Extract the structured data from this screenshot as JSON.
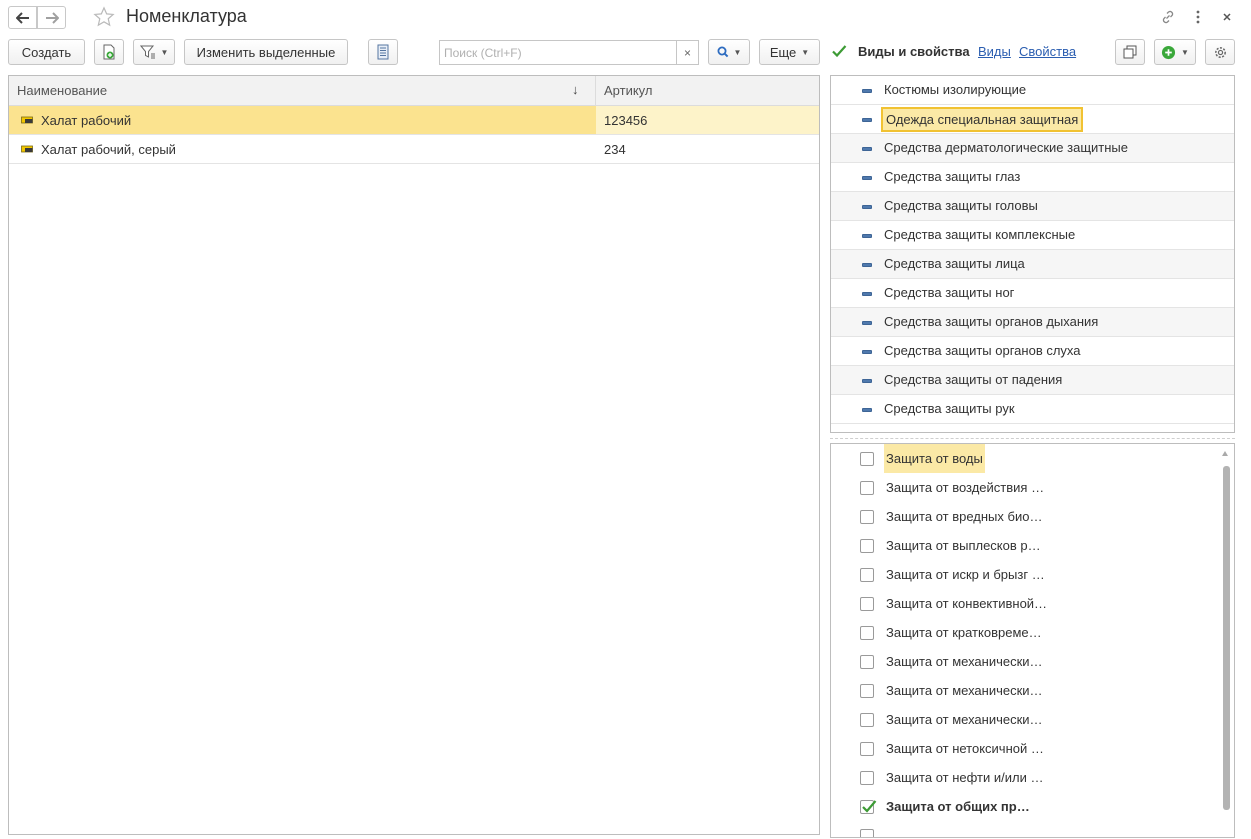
{
  "window": {
    "title": "Номенклатура",
    "back_icon": "arrow-left-icon",
    "forward_icon": "arrow-right-icon",
    "favorite_icon": "star-outline-icon",
    "link_icon": "link-icon",
    "more_icon": "more-vertical-icon",
    "close_icon": "close-icon"
  },
  "toolbar": {
    "create_label": "Создать",
    "change_selected_label": "Изменить выделенные",
    "search_placeholder": "Поиск (Ctrl+F)",
    "search_clear": "×",
    "more_label": "Еще"
  },
  "table": {
    "columns": [
      "Наименование",
      "Артикул"
    ],
    "sort_indicator": "↓",
    "rows": [
      {
        "name": "Халат рабочий",
        "article": "123456",
        "selected": true
      },
      {
        "name": "Халат рабочий, серый",
        "article": "234",
        "selected": false
      }
    ]
  },
  "right_panel": {
    "title": "Виды и свойства",
    "link_kinds": "Виды",
    "link_properties": "Свойства",
    "kinds": [
      "Костюмы изолирующие",
      "Одежда специальная защитная",
      "Средства дерматологические защитные",
      "Средства защиты глаз",
      "Средства защиты головы",
      "Средства защиты комплексные",
      "Средства защиты лица",
      "Средства защиты ног",
      "Средства защиты органов дыхания",
      "Средства защиты органов слуха",
      "Средства защиты от падения",
      "Средства защиты рук"
    ],
    "kinds_selected_index": 1,
    "properties": [
      {
        "label": "Защита от воды",
        "checked": false
      },
      {
        "label": "Защита от воздействия …",
        "checked": false
      },
      {
        "label": "Защита от вредных био…",
        "checked": false
      },
      {
        "label": "Защита от выплесков р…",
        "checked": false
      },
      {
        "label": "Защита от искр и брызг …",
        "checked": false
      },
      {
        "label": "Защита от конвективной…",
        "checked": false
      },
      {
        "label": "Защита от кратковреме…",
        "checked": false
      },
      {
        "label": "Защита от механически…",
        "checked": false
      },
      {
        "label": "Защита от механически…",
        "checked": false
      },
      {
        "label": "Защита от механически…",
        "checked": false
      },
      {
        "label": "Защита от нетоксичной …",
        "checked": false
      },
      {
        "label": "Защита от нефти и/или …",
        "checked": false
      },
      {
        "label": "Защита от общих пр…",
        "checked": true
      }
    ],
    "properties_selected_index": 0
  },
  "colors": {
    "selection": "#fbe38f",
    "selection_light": "#fdf3c9",
    "link": "#2a5db0",
    "check_green": "#3d9b35",
    "add_green": "#3aa83a"
  }
}
